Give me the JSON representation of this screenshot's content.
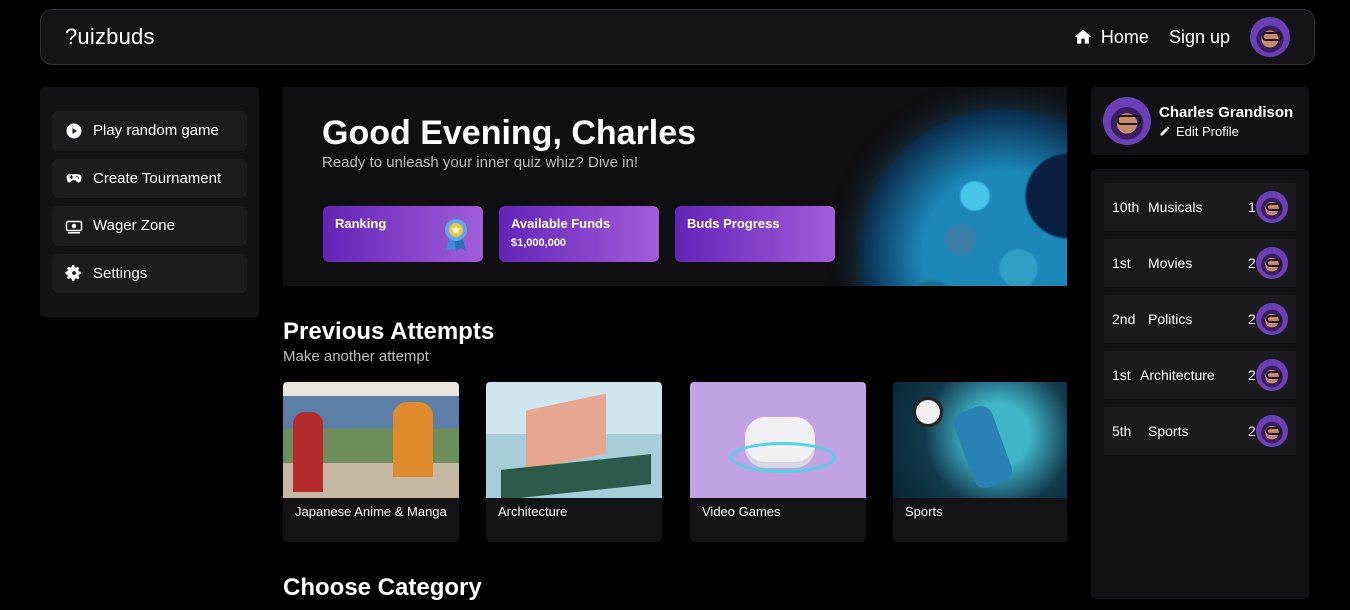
{
  "header": {
    "logo": "?uizbuds",
    "nav": {
      "home": "Home",
      "signup": "Sign up"
    }
  },
  "sidebar": {
    "items": [
      {
        "label": "Play random game",
        "icon": "play-circle-icon"
      },
      {
        "label": "Create Tournament",
        "icon": "gamepad-icon"
      },
      {
        "label": "Wager Zone",
        "icon": "money-icon"
      },
      {
        "label": "Settings",
        "icon": "gear-icon"
      }
    ]
  },
  "hero": {
    "greeting": "Good Evening, Charles",
    "subtitle": "Ready to unleash your inner quiz whiz? Dive in!",
    "stats": [
      {
        "label": "Ranking",
        "value": ""
      },
      {
        "label": "Available Funds",
        "value": "$1,000,000"
      },
      {
        "label": "Buds Progress",
        "value": ""
      }
    ]
  },
  "previous": {
    "title": "Previous Attempts",
    "subtitle": "Make another attempt",
    "cards": [
      {
        "title": "Japanese Anime & Manga"
      },
      {
        "title": "Architecture"
      },
      {
        "title": "Video Games"
      },
      {
        "title": "Sports"
      }
    ]
  },
  "choose": {
    "title": "Choose Category"
  },
  "profile": {
    "name": "Charles Grandison",
    "edit": "Edit Profile"
  },
  "leaderboard": [
    {
      "rank": "10th",
      "category": "Musicals",
      "score": "13/30"
    },
    {
      "rank": "1st",
      "category": "Movies",
      "score": "29/30"
    },
    {
      "rank": "2nd",
      "category": "Politics",
      "score": "28/30"
    },
    {
      "rank": "1st",
      "category": "Architecture",
      "score": "28/30"
    },
    {
      "rank": "5th",
      "category": "Sports",
      "score": "20/30"
    }
  ],
  "colors": {
    "background": "#000000",
    "panel": "#121214",
    "accent_start": "#6224b8",
    "accent_end": "#a15ed8"
  }
}
